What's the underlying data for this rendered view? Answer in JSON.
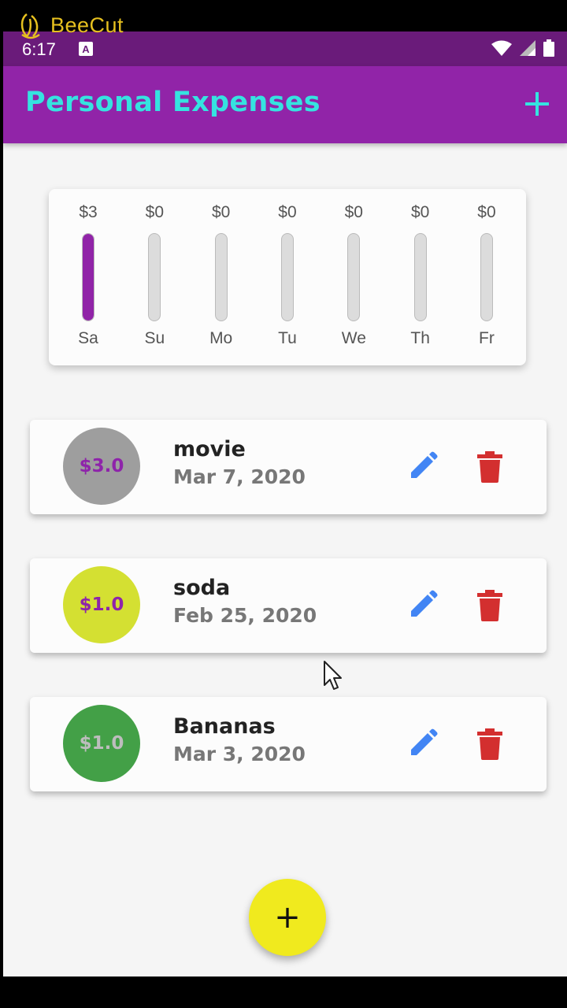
{
  "watermark": {
    "text": "BeeCut"
  },
  "status_bar": {
    "time": "6:17",
    "notification_letter": "A"
  },
  "appbar": {
    "title": "Personal Expenses",
    "add_icon": "plus-icon"
  },
  "chart": {
    "accent_color": "#9124a8",
    "track_color": "#dcdcdc"
  },
  "chart_data": {
    "type": "bar",
    "categories": [
      "Sa",
      "Su",
      "Mo",
      "Tu",
      "We",
      "Th",
      "Fr"
    ],
    "labels": [
      "$3",
      "$0",
      "$0",
      "$0",
      "$0",
      "$0",
      "$0"
    ],
    "values": [
      3,
      0,
      0,
      0,
      0,
      0,
      0
    ],
    "fill_fractions": [
      1,
      0,
      0,
      0,
      0,
      0,
      0
    ]
  },
  "transactions": [
    {
      "amount": "$3.0",
      "title": "movie",
      "date": "Mar 7, 2020",
      "avatar_color": "#9e9e9e",
      "amount_color": "#8e24aa"
    },
    {
      "amount": "$1.0",
      "title": "soda",
      "date": "Feb 25, 2020",
      "avatar_color": "#d4e032",
      "amount_color": "#8e24aa"
    },
    {
      "amount": "$1.0",
      "title": "Bananas",
      "date": "Mar 3, 2020",
      "avatar_color": "#43a047",
      "amount_color": "#bdbdbd"
    }
  ],
  "icons": {
    "edit": "pencil-icon",
    "delete": "trash-icon",
    "fab": "plus-icon"
  },
  "colors": {
    "edit": "#4285f4",
    "delete": "#d32f2f",
    "fab": "#f0ea1e",
    "title": "#35e3e0"
  },
  "fab": {
    "label": "+"
  }
}
